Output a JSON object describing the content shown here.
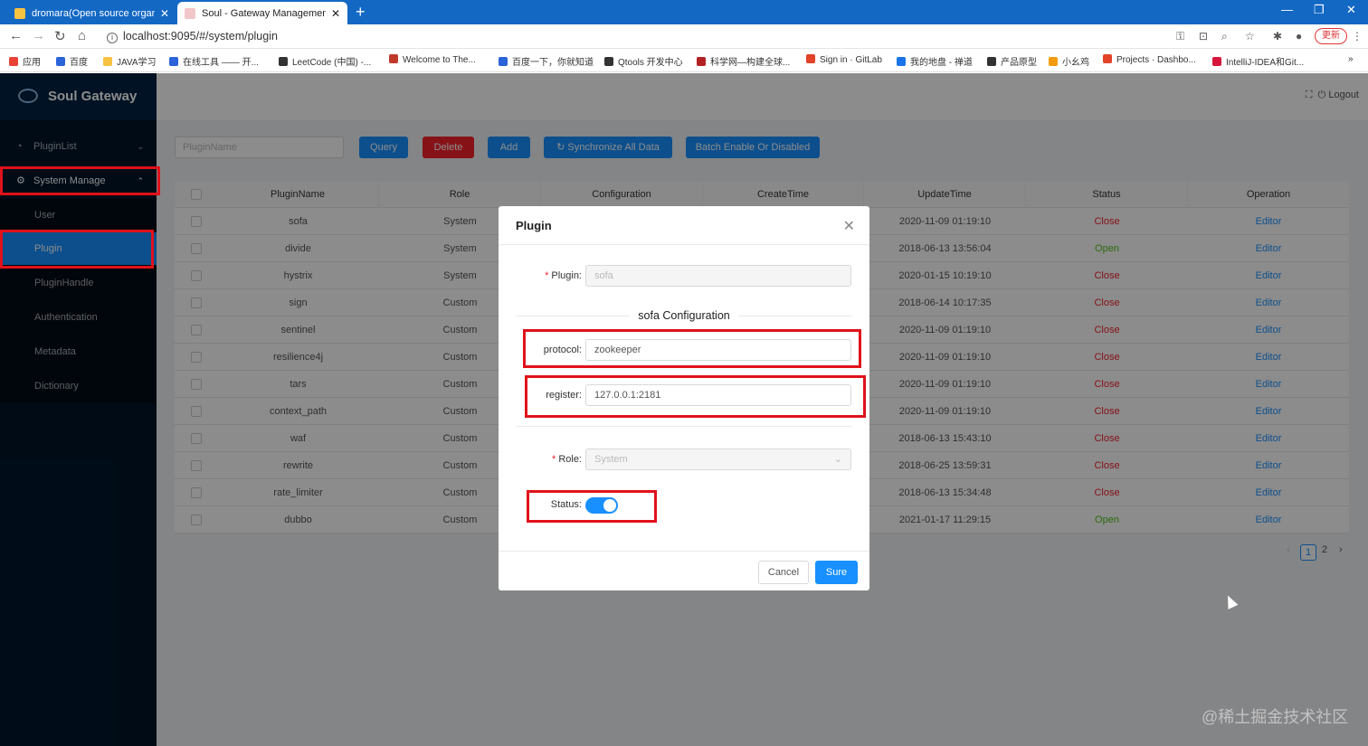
{
  "browser": {
    "tabs": [
      {
        "label": "dromara(Open source organiz",
        "favicon_color": "#f5c242"
      },
      {
        "label": "Soul - Gateway Management",
        "favicon_color": "#f3c6c9"
      }
    ],
    "url": "localhost:9095/#/system/plugin",
    "update_label": "更新",
    "bookmarks": [
      {
        "label": "应用",
        "color": "#e94235"
      },
      {
        "label": "百度",
        "color": "#2b63d8"
      },
      {
        "label": "JAVA学习",
        "color": "#f5c242"
      },
      {
        "label": "在线工具 —— 开...",
        "color": "#2b63d8"
      },
      {
        "label": "LeetCode (中国) -...",
        "color": "#333333"
      },
      {
        "label": "Welcome to The...",
        "color": "#c0392b"
      },
      {
        "label": "百度一下，你就知道",
        "color": "#2b63d8"
      },
      {
        "label": "Qtools 开发中心",
        "color": "#333333"
      },
      {
        "label": "科学网—构建全球...",
        "color": "#b22222"
      },
      {
        "label": "Sign in · GitLab",
        "color": "#e24329"
      },
      {
        "label": "我的地盘 - 禅道",
        "color": "#1a73e8"
      },
      {
        "label": "产品原型",
        "color": "#333333"
      },
      {
        "label": "小幺鸡",
        "color": "#f39c12"
      },
      {
        "label": "Projects · Dashbo...",
        "color": "#e24329"
      },
      {
        "label": "IntelliJ-IDEA和Git...",
        "color": "#d6173b"
      }
    ]
  },
  "app": {
    "logo_text": "Soul Gateway",
    "logout_label": "Logout",
    "menu": {
      "plugin_list": "PluginList",
      "system_manage": "System Manage",
      "sub_items": [
        "User",
        "Plugin",
        "PluginHandle",
        "Authentication",
        "Metadata",
        "Dictionary"
      ]
    },
    "toolbar": {
      "search_placeholder": "PluginName",
      "query": "Query",
      "delete": "Delete",
      "add": "Add",
      "sync": "Synchronize All Data",
      "batch": "Batch Enable Or Disabled"
    },
    "table": {
      "headers": [
        "PluginName",
        "Role",
        "Configuration",
        "CreateTime",
        "UpdateTime",
        "Status",
        "Operation"
      ],
      "rows": [
        {
          "name": "sofa",
          "role": "System",
          "update": "2020-11-09 01:19:10",
          "status": "Close"
        },
        {
          "name": "divide",
          "role": "System",
          "update": "2018-06-13 13:56:04",
          "status": "Open"
        },
        {
          "name": "hystrix",
          "role": "System",
          "update": "2020-01-15 10:19:10",
          "status": "Close"
        },
        {
          "name": "sign",
          "role": "Custom",
          "update": "2018-06-14 10:17:35",
          "status": "Close"
        },
        {
          "name": "sentinel",
          "role": "Custom",
          "update": "2020-11-09 01:19:10",
          "status": "Close"
        },
        {
          "name": "resilience4j",
          "role": "Custom",
          "update": "2020-11-09 01:19:10",
          "status": "Close"
        },
        {
          "name": "tars",
          "role": "Custom",
          "update": "2020-11-09 01:19:10",
          "status": "Close"
        },
        {
          "name": "context_path",
          "role": "Custom",
          "update": "2020-11-09 01:19:10",
          "status": "Close"
        },
        {
          "name": "waf",
          "role": "Custom",
          "update": "2018-06-13 15:43:10",
          "status": "Close"
        },
        {
          "name": "rewrite",
          "role": "Custom",
          "update": "2018-06-25 13:59:31",
          "status": "Close"
        },
        {
          "name": "rate_limiter",
          "role": "Custom",
          "update": "2018-06-13 15:34:48",
          "status": "Close"
        },
        {
          "name": "dubbo",
          "role": "Custom",
          "update": "2021-01-17 11:29:15",
          "status": "Open"
        }
      ],
      "operation_label": "Editor"
    },
    "pagination": {
      "current": "1",
      "next": "2"
    }
  },
  "modal": {
    "title": "Plugin",
    "plugin_label": "Plugin:",
    "plugin_value": "sofa",
    "section_title": "sofa Configuration",
    "protocol_label": "protocol:",
    "protocol_value": "zookeeper",
    "register_label": "register:",
    "register_value": "127.0.0.1:2181",
    "role_label": "Role:",
    "role_value": "System",
    "status_label": "Status:",
    "status_on": true,
    "cancel": "Cancel",
    "sure": "Sure"
  },
  "watermark": "@稀土掘金技术社区",
  "colors": {
    "primary": "#1890ff",
    "danger": "#f5222d",
    "success": "#52c41a",
    "sidebar": "#001529",
    "highlight": "#e0121b",
    "browser_tab": "#1368c4"
  }
}
